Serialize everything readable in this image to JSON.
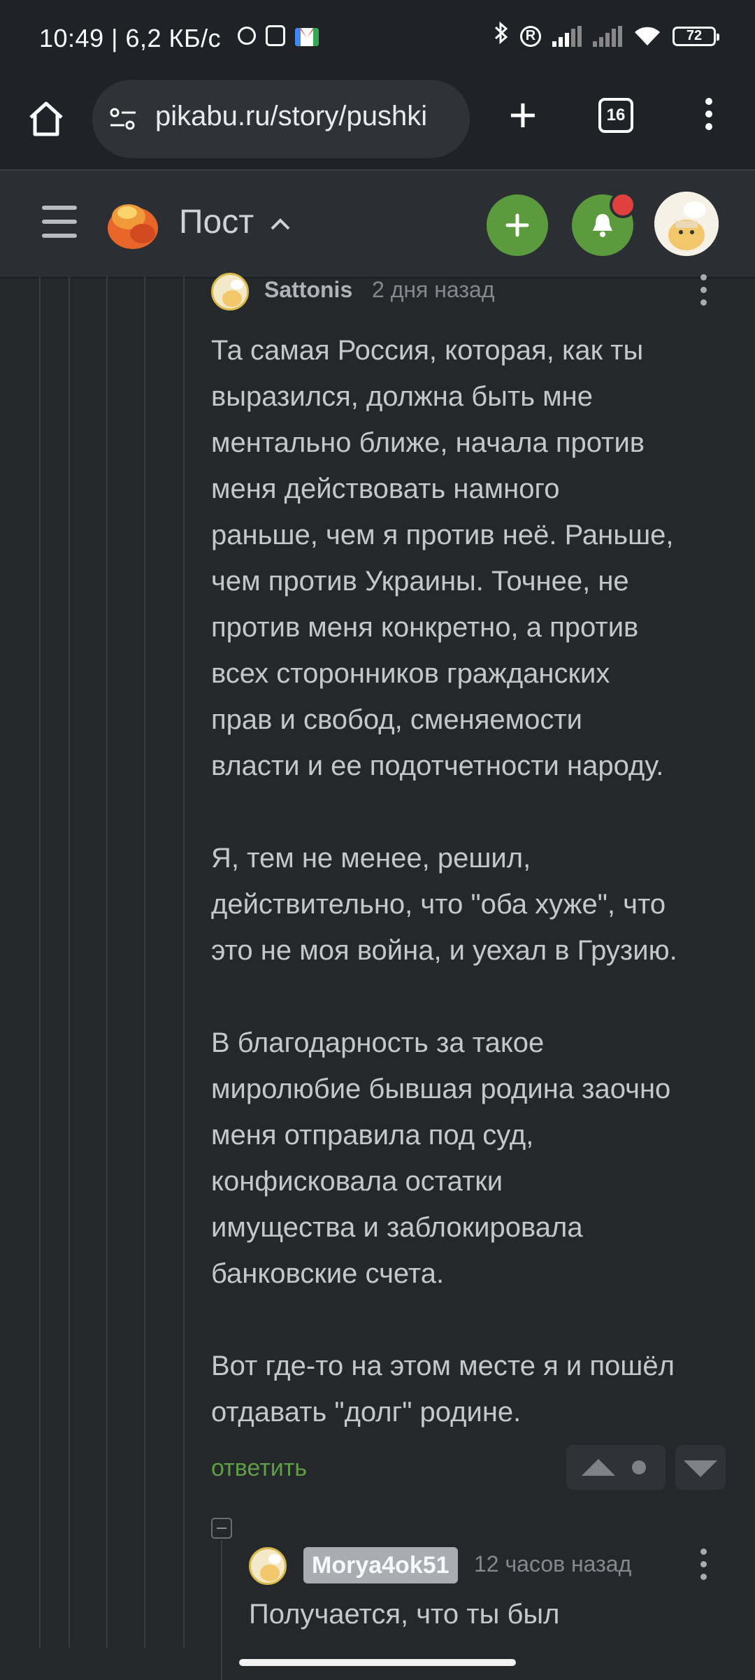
{
  "status_bar": {
    "time": "10:49",
    "speed": "| 6,2 КБ/с",
    "battery": "72"
  },
  "browser": {
    "url": "pikabu.ru/story/pushki",
    "tab_count": "16"
  },
  "header": {
    "title": "Пост"
  },
  "comment": {
    "author": "Sattonis",
    "time": "2 дня назад",
    "body": "Та самая Россия, которая, как ты\nвыразился, должна быть мне\nментально ближе, начала против\nменя действовать намного\nраньше, чем я против неё. Раньше,\nчем против Украины. Точнее, не\nпротив меня конкретно, а против\nвсех сторонников гражданских\nправ и свобод, сменяемости\nвласти и ее подотчетности народу.\n\nЯ, тем не менее, решил,\nдействительно, что \"оба хуже\", что\nэто не моя война, и уехал в Грузию.\n\nВ благодарность за такое\nмиролюбие бывшая родина заочно\nменя отправила под суд,\nконфисковала остатки\nимущества и заблокировала\nбанковские счета.\n\nВот где-то на этом месте я и пошёл\nотдавать \"долг\" родине.",
    "reply_label": "ответить"
  },
  "reply": {
    "author": "Morya4ok51",
    "time": "12 часов назад",
    "body": "Получается, что ты был"
  },
  "colors": {
    "background": "#25282b",
    "accent_green": "#5c9b3d",
    "notification_red": "#e0413f"
  },
  "icons": [
    "home-icon",
    "tune-icon",
    "plus-icon",
    "tabs-icon",
    "more-vert-icon",
    "menu-icon",
    "pikabu-logo",
    "chevron-up-icon",
    "add-icon",
    "bell-icon",
    "avatar",
    "vote-up-icon",
    "vote-down-icon",
    "collapse-icon"
  ]
}
